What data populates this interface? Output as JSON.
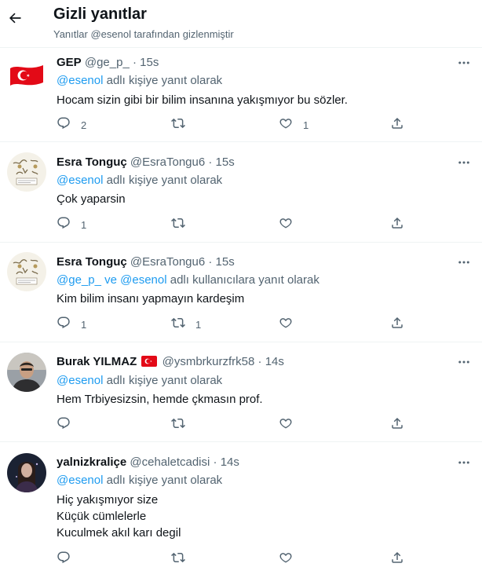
{
  "header": {
    "title": "Gizli yanıtlar",
    "subtitle": "Yanıtlar @esenol tarafından gizlenmiştir"
  },
  "colors": {
    "link": "#1d9bf0",
    "muted": "#536471",
    "text": "#0f1419",
    "flag": "#e30a17"
  },
  "tweets": [
    {
      "name": "GEP",
      "handle": "@ge_p_",
      "sep": "·",
      "time": "15s",
      "reply_to_1": "@esenol",
      "reply_mid": "",
      "reply_to_2": "",
      "reply_suffix": "adlı kişiye yanıt olarak",
      "lines": [
        "Hocam sizin gibi bir bilim insanına yakışmıyor bu sözler."
      ],
      "replies": "2",
      "retweets": "",
      "likes": "1",
      "avatar": "turkish-flag-avatar"
    },
    {
      "name": "Esra Tonguç",
      "handle": "@EsraTongu6",
      "sep": "·",
      "time": "15s",
      "reply_to_1": "@esenol",
      "reply_mid": "",
      "reply_to_2": "",
      "reply_suffix": "adlı kişiye yanıt olarak",
      "lines": [
        "Çok yaparsin"
      ],
      "replies": "1",
      "retweets": "",
      "likes": "",
      "avatar": "sketch-avatar"
    },
    {
      "name": "Esra Tonguç",
      "handle": "@EsraTongu6",
      "sep": "·",
      "time": "15s",
      "reply_to_1": "@ge_p_",
      "reply_mid": "ve",
      "reply_to_2": "@esenol",
      "reply_suffix": "adlı kullanıcılara yanıt olarak",
      "lines": [
        "Kim bilim insanı yapmayın kardeşim"
      ],
      "replies": "1",
      "retweets": "1",
      "likes": "",
      "avatar": "sketch-avatar"
    },
    {
      "name": "Burak YILMAZ",
      "handle": "@ysmbrkurzfrk58",
      "sep": "·",
      "time": "14s",
      "reply_to_1": "@esenol",
      "reply_mid": "",
      "reply_to_2": "",
      "reply_suffix": "adlı kişiye yanıt olarak",
      "lines": [
        "Hem Trbiyesizsin, hemde çkmasın prof."
      ],
      "replies": "",
      "retweets": "",
      "likes": "",
      "avatar": "man-photo-avatar"
    },
    {
      "name": "yalnizkraliçe",
      "handle": "@cehaletcadisi",
      "sep": "·",
      "time": "14s",
      "reply_to_1": "@esenol",
      "reply_mid": "",
      "reply_to_2": "",
      "reply_suffix": "adlı kişiye yanıt olarak",
      "lines": [
        "Hiç yakışmıyor size",
        "Küçük cümlelerle",
        "Kuculmek akıl karı degil"
      ],
      "replies": "",
      "retweets": "",
      "likes": "",
      "avatar": "woman-photo-avatar"
    }
  ]
}
